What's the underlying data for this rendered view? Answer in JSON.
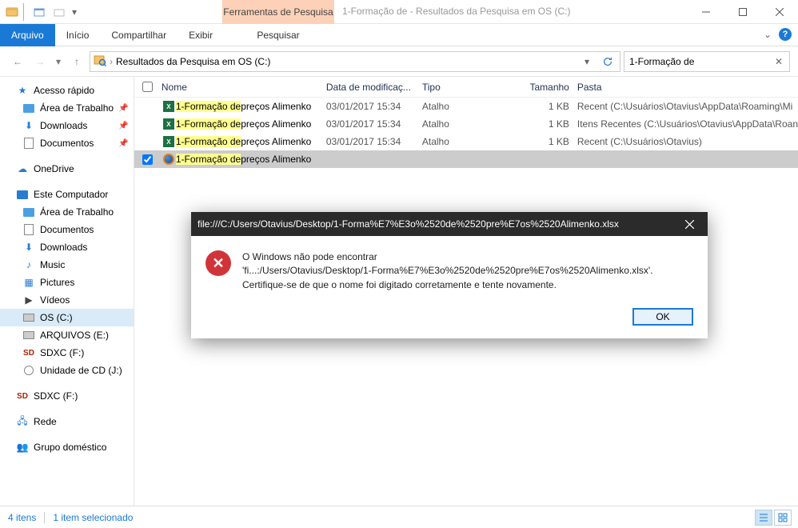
{
  "titlebar": {
    "context_tab": "Ferramentas de Pesquisa",
    "window_title": "1-Formação de - Resultados da Pesquisa em OS (C:)"
  },
  "ribbon": {
    "file_tab": "Arquivo",
    "tabs": {
      "home": "Início",
      "share": "Compartilhar",
      "view": "Exibir",
      "search": "Pesquisar"
    }
  },
  "addressbar": {
    "path": "Resultados da Pesquisa em OS (C:)"
  },
  "search": {
    "value": "1-Formação de"
  },
  "columns": {
    "name": "Nome",
    "date": "Data de modificaç...",
    "type": "Tipo",
    "size": "Tamanho",
    "folder": "Pasta"
  },
  "nav": {
    "quick_access": "Acesso rápido",
    "desktop": "Área de Trabalho",
    "downloads": "Downloads",
    "documents": "Documentos",
    "onedrive": "OneDrive",
    "this_pc": "Este Computador",
    "pc_desktop": "Área de Trabalho",
    "pc_documents": "Documentos",
    "pc_downloads": "Downloads",
    "pc_music": "Music",
    "pc_pictures": "Pictures",
    "pc_videos": "Vídeos",
    "drive_c": "OS (C:)",
    "drive_e": "ARQUIVOS (E:)",
    "drive_f": "SDXC (F:)",
    "drive_cd": "Unidade de CD (J:)",
    "sdxc2": "SDXC (F:)",
    "network": "Rede",
    "homegroup": "Grupo doméstico"
  },
  "files": [
    {
      "icon": "excel",
      "hl": "1-Formação de",
      "rest": " preços Alimenko",
      "date": "03/01/2017 15:34",
      "type": "Atalho",
      "size": "1 KB",
      "folder": "Recent (C:\\Usuários\\Otavius\\AppData\\Roaming\\Mi",
      "checked": false
    },
    {
      "icon": "excel",
      "hl": "1-Formação de",
      "rest": " preços Alimenko",
      "date": "03/01/2017 15:34",
      "type": "Atalho",
      "size": "1 KB",
      "folder": "Itens Recentes (C:\\Usuários\\Otavius\\AppData\\Roan",
      "checked": false
    },
    {
      "icon": "excel",
      "hl": "1-Formação de",
      "rest": " preços Alimenko",
      "date": "03/01/2017 15:34",
      "type": "Atalho",
      "size": "1 KB",
      "folder": "Recent (C:\\Usuários\\Otavius)",
      "checked": false
    },
    {
      "icon": "firefox",
      "hl": "1-Formação de",
      "rest": " preços Alimenko",
      "date": "",
      "type": "",
      "size": "",
      "folder": "",
      "checked": true,
      "selected": true
    }
  ],
  "dialog": {
    "title": "file:///C:/Users/Otavius/Desktop/1-Forma%E7%E3o%2520de%2520pre%E7os%2520Alimenko.xlsx",
    "line1": "O Windows não pode encontrar",
    "line2": "'fi...:/Users/Otavius/Desktop/1-Forma%E7%E3o%2520de%2520pre%E7os%2520Alimenko.xlsx'.",
    "line3": "Certifique-se de que o nome foi digitado corretamente e tente novamente.",
    "ok": "OK"
  },
  "status": {
    "items": "4 itens",
    "selected": "1 item selecionado"
  }
}
